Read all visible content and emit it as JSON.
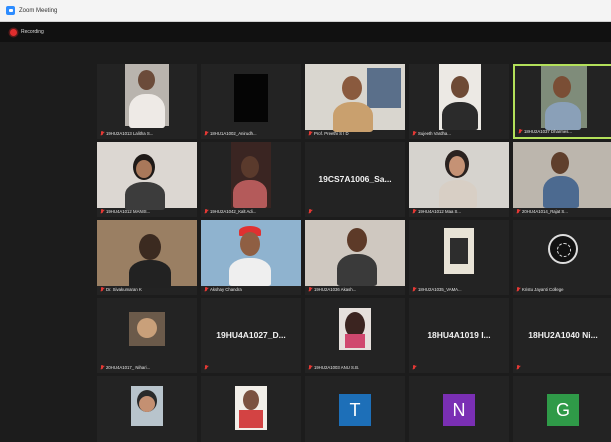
{
  "window": {
    "title": "Zoom Meeting"
  },
  "toolbar": {
    "recording_label": "Recording"
  },
  "colors": {
    "active_speaker_border": "#b3e05a",
    "muted_mic": "#e53935",
    "recording": "#e02d2d"
  },
  "participants": [
    {
      "name": "19HU2A1013 Lalitha S..."
    },
    {
      "name": "18HU1A1002_Anirudh..."
    },
    {
      "name": "Prof. Preethi S I D"
    },
    {
      "name": "Sujeeth Vardha..."
    },
    {
      "name": "18HU2A1037 Dharmes..."
    },
    {
      "name": "19HU4A1012 MANIS..."
    },
    {
      "name": "19HU2A1042_Kalt Adi..."
    },
    {
      "name": "19CS7A1006_Sa..."
    },
    {
      "name": "19HU4A1012 Maa S..."
    },
    {
      "name": "20HU4A1014_Rajat S..."
    },
    {
      "name": "Dr. Sivakumaran K"
    },
    {
      "name": "Akshay Chandra"
    },
    {
      "name": "19HU2A1036 Akash..."
    },
    {
      "name": "18HU2A1035_VAMA..."
    },
    {
      "name": "Kristu Jayanti College"
    },
    {
      "name": "20HU4A1017_ Nihari..."
    },
    {
      "name": "19HU4A1027_D..."
    },
    {
      "name": "19HU2A1003 ANU S.B."
    },
    {
      "name": "18HU4A1019 I..."
    },
    {
      "name": "18HU2A1040 Ni..."
    },
    {
      "name": ""
    },
    {
      "name": ""
    },
    {
      "name": "",
      "initial": "T"
    },
    {
      "name": "",
      "initial": "N"
    },
    {
      "name": "",
      "initial": "G"
    }
  ]
}
